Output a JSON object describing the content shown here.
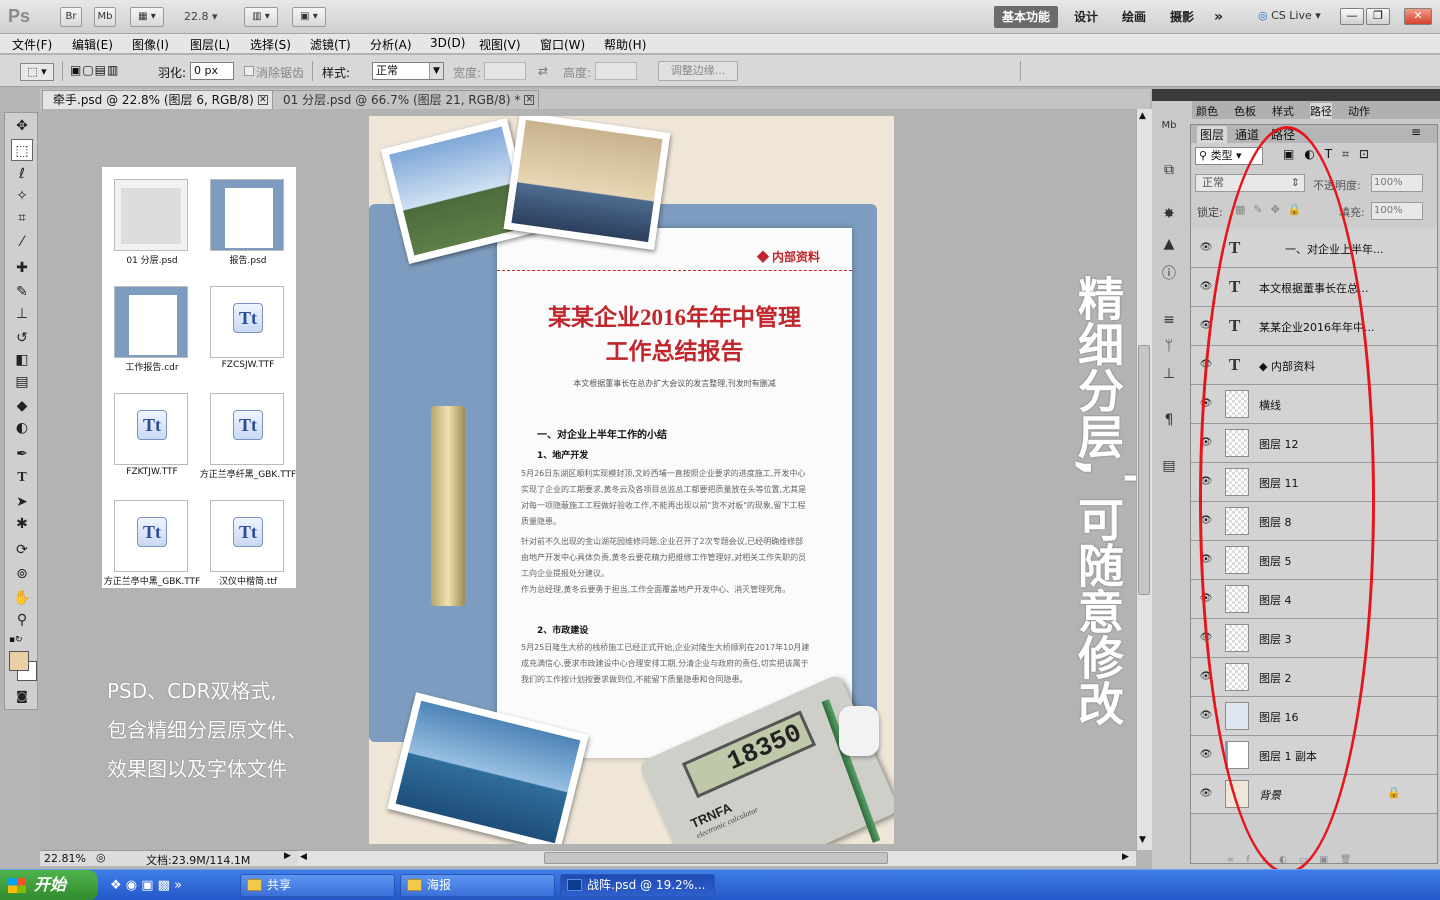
{
  "app": {
    "logo": "Ps",
    "bridge": "Br",
    "minibridge": "Mb",
    "zoom_value": "22.8",
    "workspaces": [
      "基本功能",
      "设计",
      "绘画",
      "摄影"
    ],
    "more": "»",
    "cslive": "CS Live",
    "window_buttons": [
      "—",
      "❐",
      "✕"
    ]
  },
  "menu": [
    "文件(F)",
    "编辑(E)",
    "图像(I)",
    "图层(L)",
    "选择(S)",
    "滤镜(T)",
    "分析(A)",
    "3D(D)",
    "视图(V)",
    "窗口(W)",
    "帮助(H)"
  ],
  "options": {
    "feather_label": "羽化:",
    "feather_value": "0 px",
    "antialias_label": "消除锯齿",
    "style_label": "样式:",
    "style_value": "正常",
    "width_label": "宽度:",
    "height_label": "高度:",
    "refine_label": "调整边缘..."
  },
  "tabs": [
    {
      "label": "牵手.psd @ 22.8% (图层 6, RGB/8)",
      "close": "✕"
    },
    {
      "label": "01 分层.psd @ 66.7% (图层 21, RGB/8) *",
      "close": "✕"
    }
  ],
  "files": [
    {
      "name": "01 分层.psd"
    },
    {
      "name": "报告.psd"
    },
    {
      "name": "工作报告.cdr"
    },
    {
      "name": "FZCSJW.TTF"
    },
    {
      "name": "FZKTJW.TTF"
    },
    {
      "name": "方正兰亭纤黑_GBK.TTF"
    },
    {
      "name": "方正兰亭中黑_GBK.TTF"
    },
    {
      "name": "汉仪中楷简.ttf"
    }
  ],
  "font_icon": "Tt",
  "caption_lines": [
    "PSD、CDR双格式,",
    "包含精细分层原文件、",
    "效果图以及字体文件"
  ],
  "poster": {
    "tag": "◆ 内部资料",
    "title_line1": "某某企业2016年年中管理",
    "title_line2": "工作总结报告",
    "subtitle": "本文根据董事长在总办扩大会议的发言整理,刊发时有删减",
    "h1": "一、对企业上半年工作的小结",
    "h2a": "1、地产开发",
    "p1": "5月26日东湖区顺利实现模封顶,文岭西埔一直按照企业要求的进度施工,开发中心实现了企业的工期要求,黄冬云及各项目总监总工都要把质量放在头等位置,尤其是对每一项隐蔽施工工程做好验收工作,不能再出现以前\"货不对板\"的现象,留下工程质量隐患。",
    "p2": "针对前不久出现的金山湖花园维修问题,企业召开了2次专题会议,已经明确维修部由地产开发中心具体负责,黄冬云要花精力把维修工作管理好,对相关工作失职的员工向企业提报处分建议。",
    "p3": "作为总经理,黄冬云要勇于担当,工作全面覆盖地产开发中心、消灭管理死角。",
    "h2b": "2、市政建设",
    "p4": "5月25日隆生大桥的栈桥施工已经正式开始,企业对隆生大桥顺利在2017年10月建成充满信心,要求市政建设中心合理安排工期,分清企业与政府的责任,切实把该属于我们的工作按计划按要求做到位,不能留下质量隐患和合同隐患。",
    "calc_display": "18350",
    "calc_brand": "TRNFA",
    "calc_sub": "electronic calculator"
  },
  "overlay": {
    "line1": "精细分层,",
    "line2": "可随意修改",
    "arrow": "➔"
  },
  "panels": {
    "top_tabs": [
      "颜色",
      "色板",
      "样式",
      "路径",
      "动作"
    ],
    "layer_tabs": [
      "图层",
      "通道",
      "路径"
    ],
    "filter_kind": "类型",
    "blend_mode": "正常",
    "opacity_label": "不透明度:",
    "opacity_value": "100%",
    "lock_label": "锁定:",
    "fill_label": "填充:",
    "fill_value": "100%"
  },
  "layers": [
    {
      "name": "一、对企业上半年...",
      "kind": "text"
    },
    {
      "name": "本文根据董事长在总...",
      "kind": "text"
    },
    {
      "name": "某某企业2016年年中...",
      "kind": "text"
    },
    {
      "name": "◆ 内部资料",
      "kind": "text"
    },
    {
      "name": "横线",
      "kind": "smart"
    },
    {
      "name": "图层 12",
      "kind": "pixel"
    },
    {
      "name": "图层 11",
      "kind": "pixel"
    },
    {
      "name": "图层 8",
      "kind": "pixel"
    },
    {
      "name": "图层 5",
      "kind": "pixel"
    },
    {
      "name": "图层 4",
      "kind": "pixel"
    },
    {
      "name": "图层 3",
      "kind": "pixel"
    },
    {
      "name": "图层 2",
      "kind": "pixel"
    },
    {
      "name": "图层 16",
      "kind": "pixel"
    },
    {
      "name": "图层 1 副本",
      "kind": "pixel"
    },
    {
      "name": "背景",
      "kind": "background"
    }
  ],
  "text_layer_icon": "T",
  "status": {
    "zoom": "22.81%",
    "doc": "文档:23.9M/114.1M"
  },
  "taskbar": {
    "start": "开始",
    "tasks": [
      "共享",
      "海报",
      "战阵.psd @ 19.2%..."
    ]
  },
  "colors": {
    "accent_red": "#c0262c",
    "folder_blue": "#7d9cbf",
    "highlight_ellipse": "#e8141c",
    "foreground_swatch": "#e9cfa4"
  }
}
